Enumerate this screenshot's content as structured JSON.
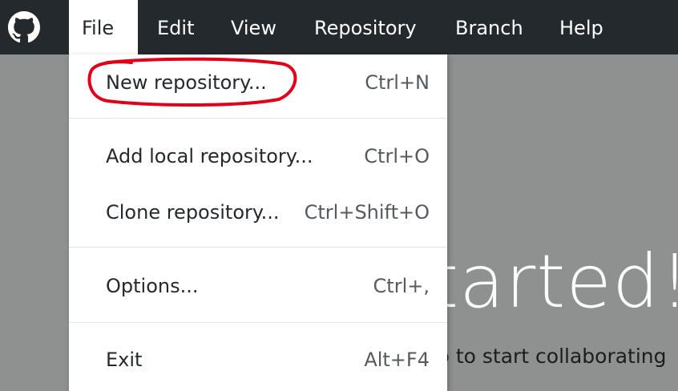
{
  "menubar": {
    "logo_icon": "github-octocat-icon",
    "items": [
      "File",
      "Edit",
      "View",
      "Repository",
      "Branch",
      "Help"
    ],
    "active": "File"
  },
  "background": {
    "title_fragment": "tarted!",
    "subtitle_fragment": "p to start collaborating"
  },
  "file_menu": {
    "items": [
      {
        "label": "New repository...",
        "accelerator": "Ctrl+N"
      },
      {
        "label": "Add local repository...",
        "accelerator": "Ctrl+O"
      },
      {
        "label": "Clone repository...",
        "accelerator": "Ctrl+Shift+O"
      },
      {
        "label": "Options...",
        "accelerator": "Ctrl+,"
      },
      {
        "label": "Exit",
        "accelerator": "Alt+F4"
      }
    ]
  },
  "annotation": {
    "color": "#e0001a"
  }
}
